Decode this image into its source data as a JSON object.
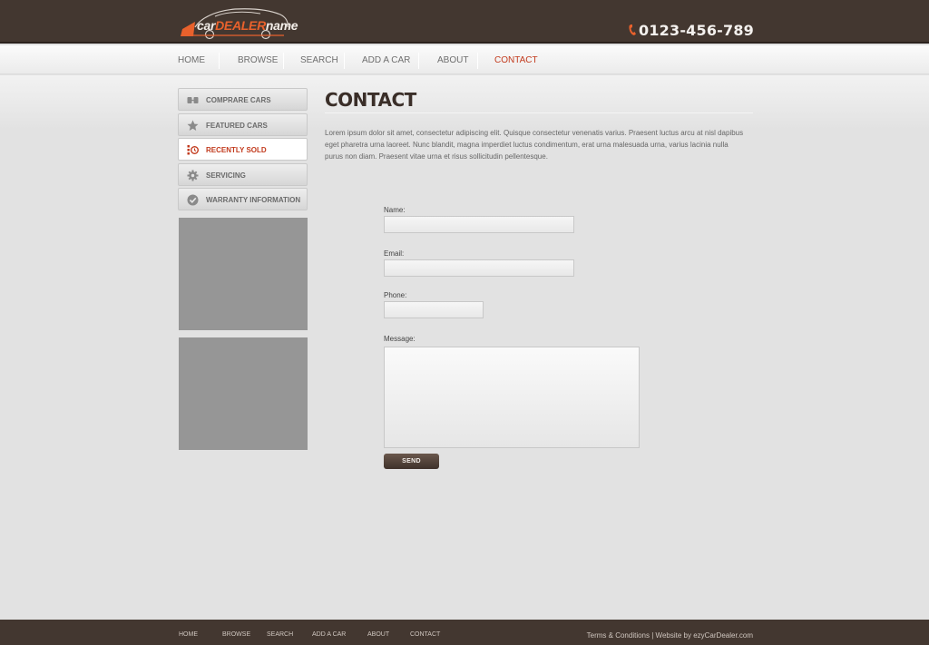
{
  "header": {
    "logo": {
      "part1": "car",
      "part2": "DEALER",
      "part3": "name"
    },
    "phone": "0123-456-789"
  },
  "nav": {
    "items": [
      "HOME",
      "BROWSE",
      "SEARCH",
      "ADD A CAR",
      "ABOUT",
      "CONTACT"
    ],
    "active": "CONTACT"
  },
  "sidebar": {
    "items": [
      {
        "label": "COMPRARE CARS",
        "icon": "compare-icon"
      },
      {
        "label": "FEATURED CARS",
        "icon": "star-icon"
      },
      {
        "label": "RECENTLY SOLD",
        "icon": "sold-icon",
        "active": true
      },
      {
        "label": "SERVICING",
        "icon": "gear-icon"
      },
      {
        "label": "WARRANTY INFORMATION",
        "icon": "checkmark-icon"
      }
    ]
  },
  "main": {
    "title": "CONTACT",
    "intro": "Lorem ipsum dolor sit amet, consectetur adipiscing elit. Quisque consectetur venenatis varius. Praesent luctus arcu at nisl dapibus eget pharetra urna laoreet. Nunc blandit, magna imperdiet luctus condimentum, erat urna malesuada urna, varius lacinia nulla purus non diam. Praesent vitae urna et risus sollicitudin pellentesque."
  },
  "form": {
    "name_label": "Name:",
    "email_label": "Email:",
    "phone_label": "Phone:",
    "message_label": "Message:",
    "name_value": "",
    "email_value": "",
    "phone_value": "",
    "message_value": "",
    "send_label": "SEND"
  },
  "footer": {
    "items": [
      "HOME",
      "BROWSE",
      "SEARCH",
      "ADD A CAR",
      "ABOUT",
      "CONTACT"
    ],
    "terms": "Terms & Conditions",
    "separator": "|",
    "credit": "Website by ezyCarDealer.com"
  },
  "colors": {
    "header_bg": "#433730",
    "accent": "#c23a1d",
    "logo_orange": "#e8612c",
    "page_bg": "#e2e2e2"
  }
}
